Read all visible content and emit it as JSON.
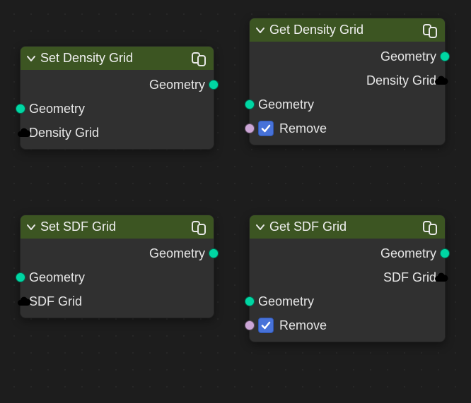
{
  "colors": {
    "header_bg": "#3c5522",
    "node_bg": "#303030",
    "socket_geometry": "#00d6a3",
    "socket_bool": "#cca6d6",
    "checkbox_bg": "#4772d9"
  },
  "nodes": {
    "set_density": {
      "title": "Set Density Grid",
      "outputs": {
        "geometry": "Geometry"
      },
      "inputs": {
        "geometry": "Geometry",
        "grid": "Density Grid"
      }
    },
    "get_density": {
      "title": "Get Density Grid",
      "outputs": {
        "geometry": "Geometry",
        "grid": "Density Grid"
      },
      "inputs": {
        "geometry": "Geometry",
        "remove": "Remove"
      },
      "remove_checked": true
    },
    "set_sdf": {
      "title": "Set SDF Grid",
      "outputs": {
        "geometry": "Geometry"
      },
      "inputs": {
        "geometry": "Geometry",
        "grid": "SDF Grid"
      }
    },
    "get_sdf": {
      "title": "Get SDF Grid",
      "outputs": {
        "geometry": "Geometry",
        "grid": "SDF Grid"
      },
      "inputs": {
        "geometry": "Geometry",
        "remove": "Remove"
      },
      "remove_checked": true
    }
  }
}
